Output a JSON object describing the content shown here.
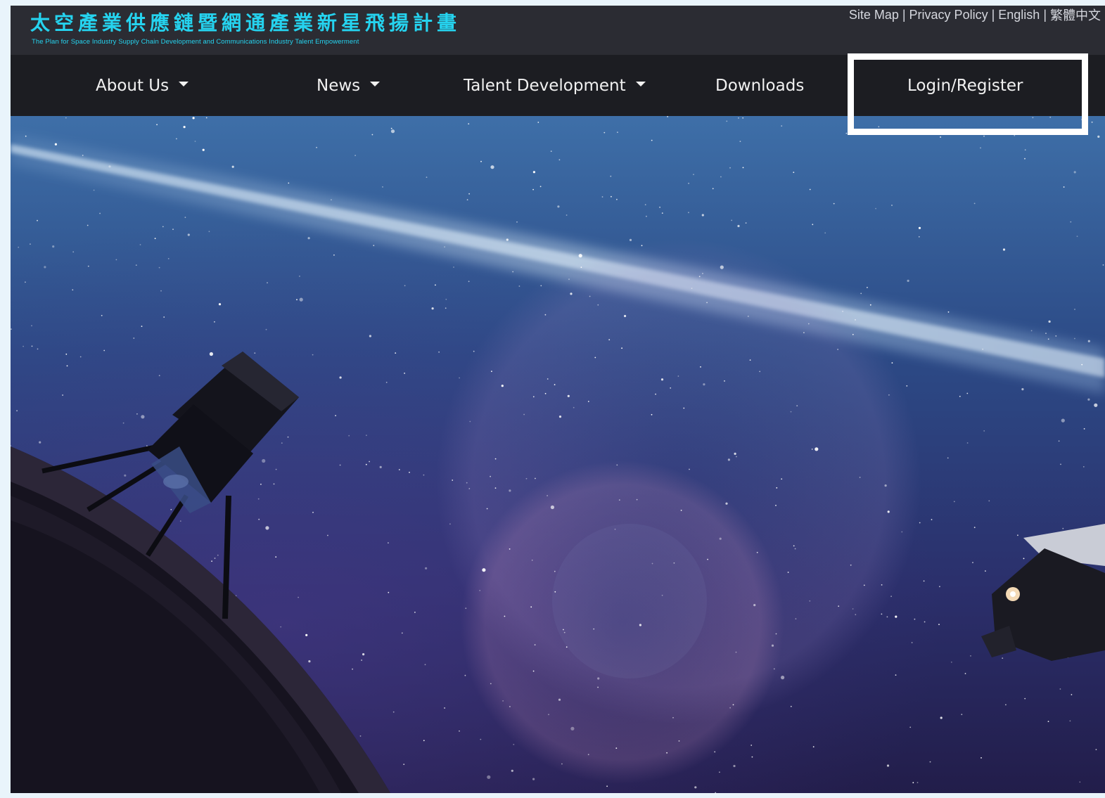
{
  "header": {
    "title": "太空產業供應鏈暨網通產業新星飛揚計畫",
    "subtitle": "The Plan for Space Industry Supply Chain Development and Communications Industry Talent Empowerment"
  },
  "utility_links": {
    "site_map": "Site Map",
    "privacy_policy": "Privacy Policy",
    "english": "English",
    "traditional_chinese": "繁體中文",
    "separator": "|"
  },
  "nav": {
    "about_us": "About Us",
    "news": "News",
    "talent_development": "Talent Development",
    "downloads": "Downloads",
    "login_register": "Login/Register"
  },
  "colors": {
    "brand_cyan": "#25d3ef",
    "header_bg": "#2b2c33",
    "nav_bg": "#1c1d22",
    "highlight": "#ffffff"
  },
  "icons": {
    "dropdown": "caret-down-icon"
  }
}
